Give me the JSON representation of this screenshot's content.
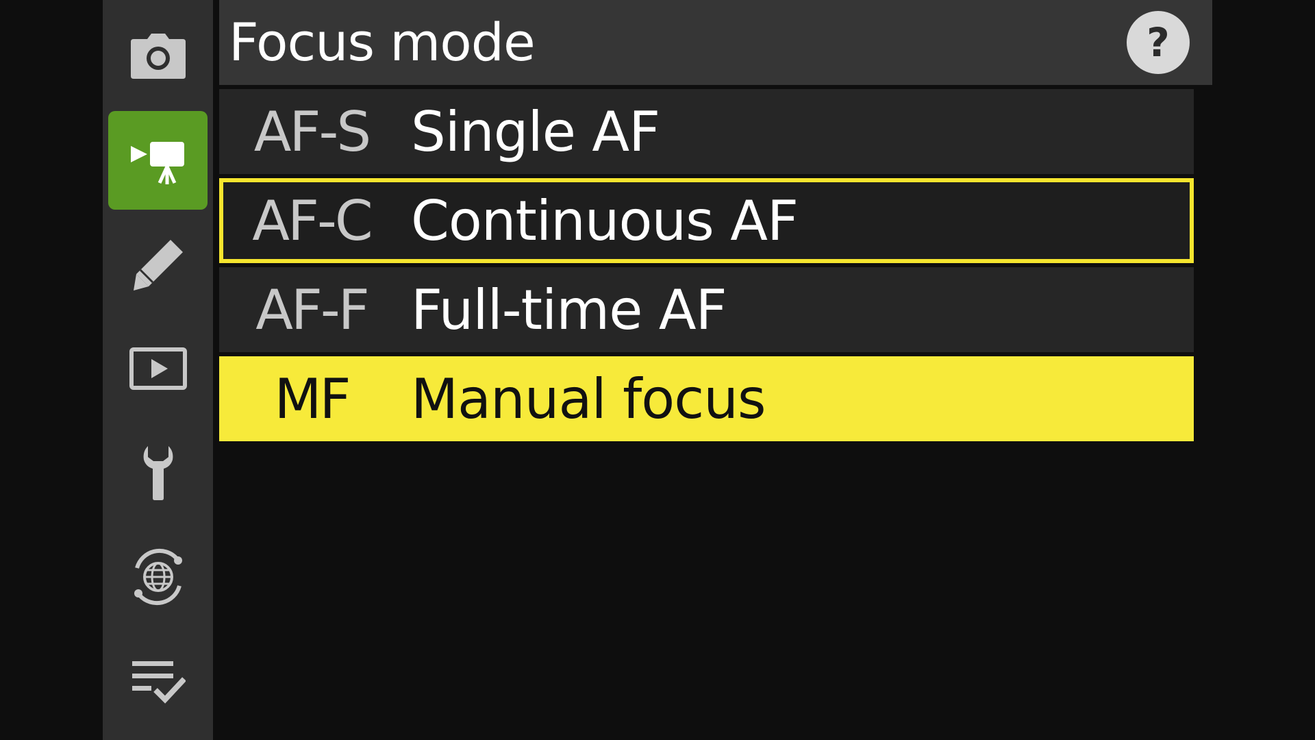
{
  "title_bar": {
    "title": "Focus mode",
    "help_label": "?"
  },
  "sidebar": {
    "items": [
      {
        "icon": "photo-shooting-icon",
        "active": false
      },
      {
        "icon": "video-recording-icon",
        "active": true
      },
      {
        "icon": "pencil-icon",
        "active": false
      },
      {
        "icon": "playback-icon",
        "active": false
      },
      {
        "icon": "wrench-icon",
        "active": false
      },
      {
        "icon": "network-icon",
        "active": false
      },
      {
        "icon": "my-menu-icon",
        "active": false
      }
    ]
  },
  "menu": {
    "items": [
      {
        "code": "AF-S",
        "label": "Single AF",
        "state": "normal"
      },
      {
        "code": "AF-C",
        "label": "Continuous AF",
        "state": "highlighted"
      },
      {
        "code": "AF-F",
        "label": "Full-time AF",
        "state": "normal"
      },
      {
        "code": "MF",
        "label": "Manual focus",
        "state": "selected"
      }
    ]
  },
  "colors": {
    "active_tab": "#5a9b23",
    "selection": "#f7ea3a",
    "highlight_border": "#f5e52e"
  }
}
